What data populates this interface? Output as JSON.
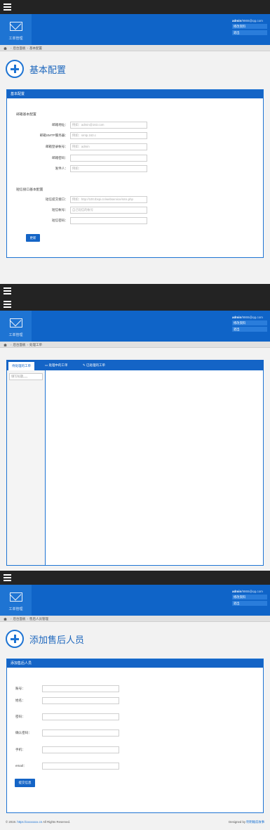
{
  "header": {
    "nav_label": "工单管理",
    "user_name": "admin",
    "user_domain": "/9865@qq.com",
    "profile_btn": "修改资料",
    "logout_btn": "退出"
  },
  "screen1": {
    "breadcrumb": [
      "后台面板",
      "基本配置"
    ],
    "page_title": "基本配置",
    "panel_title": "基本配置",
    "mail_section": "邮箱基本配置",
    "mail_fields": [
      {
        "label": "邮箱地址：",
        "placeholder": "例如：admin@163.com"
      },
      {
        "label": "邮箱SMTP服务器：",
        "placeholder": "例如：smtp.163.c"
      },
      {
        "label": "邮箱登录帐号：",
        "placeholder": "例如：admin"
      },
      {
        "label": "邮箱密码：",
        "placeholder": ""
      },
      {
        "label": "发件人：",
        "placeholder": "例如："
      }
    ],
    "sms_section": "短信接口基本配置",
    "sms_fields": [
      {
        "label": "短信提交接口：",
        "placeholder": "例如：http://100.tbspi.cn/webservice/sms.php"
      },
      {
        "label": "短信帐号：",
        "placeholder": "自己短信的帐号"
      },
      {
        "label": "短信密码：",
        "placeholder": ""
      }
    ],
    "submit": "更新"
  },
  "screen2": {
    "breadcrumb": [
      "后台面板",
      "处理工单"
    ],
    "tabs": [
      "待处理的工单",
      "处理中的工单",
      "已处理的工单"
    ],
    "search_placeholder": "填写标题。。。"
  },
  "screen3": {
    "breadcrumb": [
      "后台面板",
      "售后人员管理"
    ],
    "page_title": "添加售后人员",
    "panel_title": "添加售后人员",
    "fields": [
      {
        "label": "账号："
      },
      {
        "label": "姓名："
      },
      {
        "label": "密码："
      },
      {
        "label": "确认密码："
      },
      {
        "label": "手机："
      },
      {
        "label": "email："
      }
    ],
    "submit": "提交信息"
  },
  "footer": {
    "copyright": "© 2019.",
    "link": "https://xxxxxxxx.cn",
    "rights": "All Rights Reserved.",
    "designed_by": "Designed by",
    "designer": "明明睡前故事"
  }
}
